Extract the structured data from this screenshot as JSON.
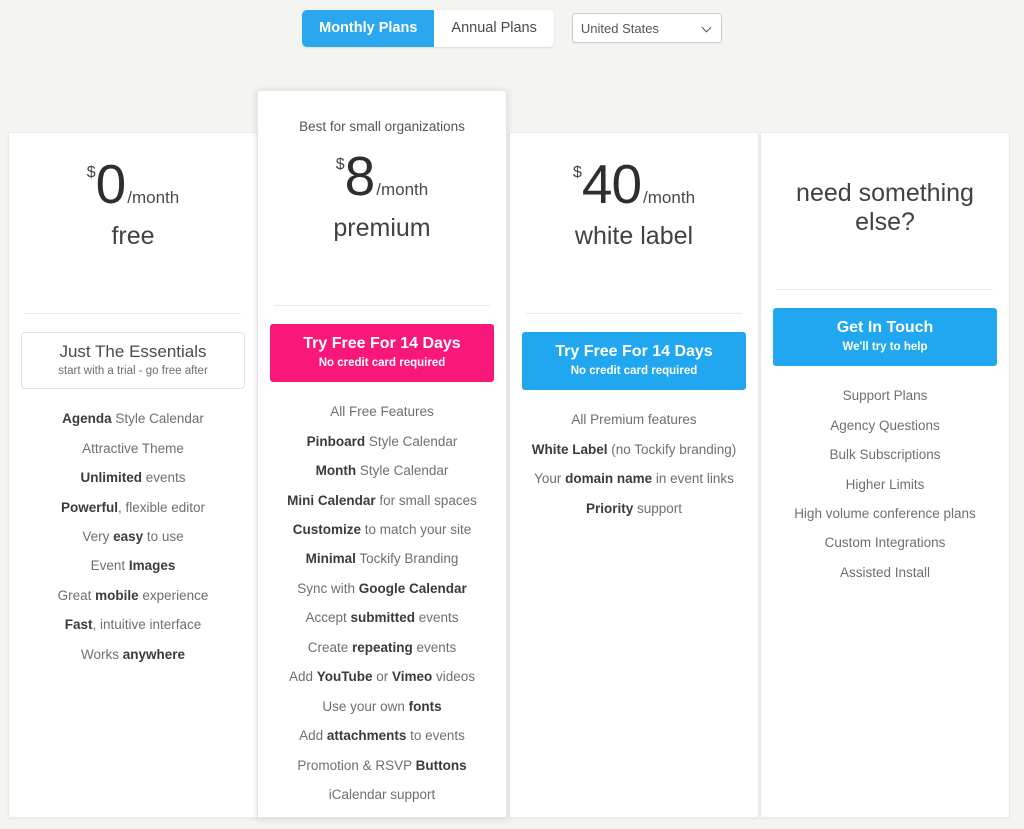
{
  "toolbar": {
    "plan_toggle": [
      {
        "label": "Monthly Plans",
        "active": true
      },
      {
        "label": "Annual Plans",
        "active": false
      }
    ],
    "country_select": {
      "value": "United States",
      "icon": "chevron-down-icon"
    }
  },
  "cards": [
    {
      "id": "free",
      "featured": false,
      "blurb": "",
      "currency": "$",
      "amount": "0",
      "per": "/month",
      "plan_name": "free",
      "cta": {
        "style": "ghost",
        "main": "Just The Essentials",
        "sub": "start with a trial - go free after"
      },
      "features": [
        [
          {
            "t": "Agenda",
            "b": true
          },
          {
            "t": " Style Calendar",
            "b": false
          }
        ],
        [
          {
            "t": "Attractive Theme",
            "b": false
          }
        ],
        [
          {
            "t": "Unlimited",
            "b": true
          },
          {
            "t": " events",
            "b": false
          }
        ],
        [
          {
            "t": "Powerful",
            "b": true
          },
          {
            "t": ", flexible editor",
            "b": false
          }
        ],
        [
          {
            "t": "Very ",
            "b": false
          },
          {
            "t": "easy",
            "b": true
          },
          {
            "t": " to use",
            "b": false
          }
        ],
        [
          {
            "t": "Event ",
            "b": false
          },
          {
            "t": "Images",
            "b": true
          }
        ],
        [
          {
            "t": "Great ",
            "b": false
          },
          {
            "t": "mobile",
            "b": true
          },
          {
            "t": " experience",
            "b": false
          }
        ],
        [
          {
            "t": "Fast",
            "b": true
          },
          {
            "t": ", intuitive interface",
            "b": false
          }
        ],
        [
          {
            "t": "Works ",
            "b": false
          },
          {
            "t": "anywhere",
            "b": true
          }
        ]
      ]
    },
    {
      "id": "premium",
      "featured": true,
      "blurb": "Best for small organizations",
      "currency": "$",
      "amount": "8",
      "per": "/month",
      "plan_name": "premium",
      "cta": {
        "style": "pink",
        "main": "Try Free For 14 Days",
        "sub": "No credit card required"
      },
      "features": [
        [
          {
            "t": "All Free Features",
            "b": false
          }
        ],
        [
          {
            "t": "Pinboard",
            "b": true
          },
          {
            "t": " Style Calendar",
            "b": false
          }
        ],
        [
          {
            "t": "Month",
            "b": true
          },
          {
            "t": " Style Calendar",
            "b": false
          }
        ],
        [
          {
            "t": "Mini Calendar",
            "b": true
          },
          {
            "t": " for small spaces",
            "b": false
          }
        ],
        [
          {
            "t": "Customize",
            "b": true
          },
          {
            "t": " to match your site",
            "b": false
          }
        ],
        [
          {
            "t": "Minimal",
            "b": true
          },
          {
            "t": " Tockify Branding",
            "b": false
          }
        ],
        [
          {
            "t": "Sync with ",
            "b": false
          },
          {
            "t": "Google Calendar",
            "b": true
          }
        ],
        [
          {
            "t": "Accept ",
            "b": false
          },
          {
            "t": "submitted",
            "b": true
          },
          {
            "t": " events",
            "b": false
          }
        ],
        [
          {
            "t": "Create ",
            "b": false
          },
          {
            "t": "repeating",
            "b": true
          },
          {
            "t": " events",
            "b": false
          }
        ],
        [
          {
            "t": "Add ",
            "b": false
          },
          {
            "t": "YouTube",
            "b": true
          },
          {
            "t": " or ",
            "b": false
          },
          {
            "t": "Vimeo",
            "b": true
          },
          {
            "t": " videos",
            "b": false
          }
        ],
        [
          {
            "t": "Use your own ",
            "b": false
          },
          {
            "t": "fonts",
            "b": true
          }
        ],
        [
          {
            "t": "Add ",
            "b": false
          },
          {
            "t": "attachments",
            "b": true
          },
          {
            "t": " to events",
            "b": false
          }
        ],
        [
          {
            "t": "Promotion & RSVP ",
            "b": false
          },
          {
            "t": "Buttons",
            "b": true
          }
        ],
        [
          {
            "t": "iCalendar support",
            "b": false
          }
        ]
      ]
    },
    {
      "id": "white-label",
      "featured": false,
      "blurb": "",
      "currency": "$",
      "amount": "40",
      "per": "/month",
      "plan_name": "white label",
      "cta": {
        "style": "blue",
        "main": "Try Free For 14 Days",
        "sub": "No credit card required"
      },
      "features": [
        [
          {
            "t": "All Premium features",
            "b": false
          }
        ],
        [
          {
            "t": "White Label",
            "b": true
          },
          {
            "t": " (no Tockify branding)",
            "b": false
          }
        ],
        [
          {
            "t": "Your ",
            "b": false
          },
          {
            "t": "domain name",
            "b": true
          },
          {
            "t": " in event links",
            "b": false
          }
        ],
        [
          {
            "t": "Priority",
            "b": true
          },
          {
            "t": " support",
            "b": false
          }
        ]
      ]
    },
    {
      "id": "contact",
      "featured": false,
      "blurb": "",
      "currency": "",
      "amount": "",
      "per": "",
      "plan_name": "need something else?",
      "cta": {
        "style": "blue",
        "main": "Get In Touch",
        "sub": "We'll try to help"
      },
      "features": [
        [
          {
            "t": "Support Plans",
            "b": false
          }
        ],
        [
          {
            "t": "Agency Questions",
            "b": false
          }
        ],
        [
          {
            "t": "Bulk Subscriptions",
            "b": false
          }
        ],
        [
          {
            "t": "Higher Limits",
            "b": false
          }
        ],
        [
          {
            "t": "High volume conference plans",
            "b": false
          }
        ],
        [
          {
            "t": "Custom Integrations",
            "b": false
          }
        ],
        [
          {
            "t": "Assisted Install",
            "b": false
          }
        ]
      ]
    }
  ],
  "colors": {
    "page_background": "#f4f4f1",
    "accent_blue": "#20a7f0",
    "accent_pink": "#f9187a",
    "card_background": "#ffffff"
  }
}
